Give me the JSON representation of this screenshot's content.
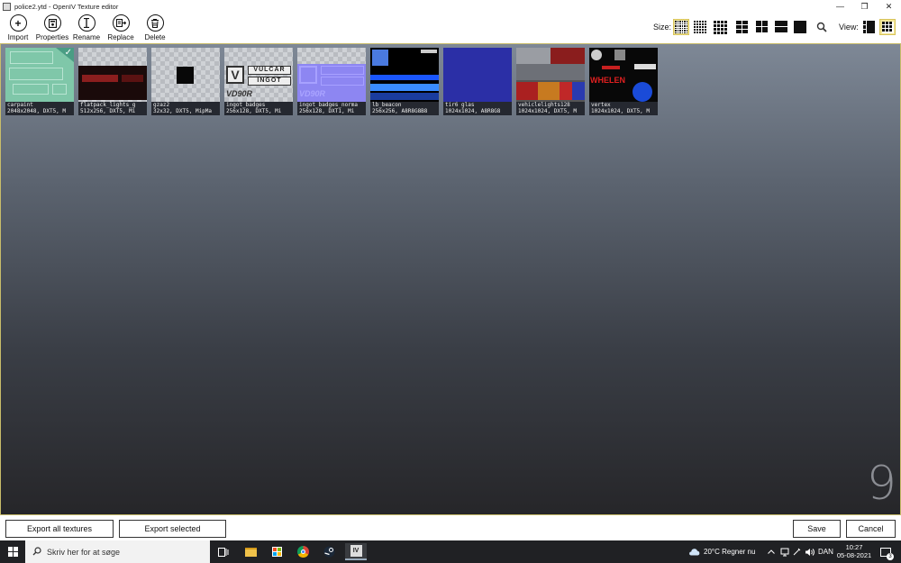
{
  "window": {
    "title": "police2.ytd - OpenIV Texture editor",
    "controls": [
      "—",
      "❐",
      "✕"
    ]
  },
  "toolbar": {
    "import_label": "Import",
    "properties_label": "Properties",
    "rename_label": "Rename",
    "replace_label": "Replace",
    "delete_label": "Delete",
    "size_label": "Size:",
    "view_label": "View:"
  },
  "textures": [
    {
      "name": "carpaint",
      "info": "2048x2048, DXT5, M"
    },
    {
      "name": "flatpack_lights_g",
      "info": "512x256, DXT5, Mi"
    },
    {
      "name": "gzaz2",
      "info": "32x32, DXT5, MipMa"
    },
    {
      "name": "ingot_badges",
      "info": "256x128, DXT5, Mi"
    },
    {
      "name": "ingot_badges_norma",
      "info": "256x128, DXT1, Mi"
    },
    {
      "name": "lb_beacon",
      "info": "256x256, A8R8G8B8"
    },
    {
      "name": "tir6 glas",
      "info": "1024x1024, A8R8G8"
    },
    {
      "name": "vehiclelights128",
      "info": "1024x1024, DXT5, M"
    },
    {
      "name": "vertex",
      "info": "1024x1024, DXT5, M"
    }
  ],
  "badge_text": {
    "vulcar": "VULCAR",
    "ingot": "INGOT",
    "vd90r": "VD90R",
    "whelen": "WHELEN"
  },
  "texture_count": "9",
  "bottom": {
    "export_all": "Export all textures",
    "export_selected": "Export selected",
    "save": "Save",
    "cancel": "Cancel"
  },
  "taskbar": {
    "search_placeholder": "Skriv her for at søge",
    "weather": "20°C  Regner nu",
    "language": "DAN",
    "time": "10:27",
    "date": "05-08-2021",
    "notification_count": "3"
  },
  "colors": {
    "selected_size_bg": "#f3e79a",
    "selected_tile": "#7fc7a9",
    "check_corner": "#4a9d84",
    "window_border": "#c9bd6a"
  }
}
